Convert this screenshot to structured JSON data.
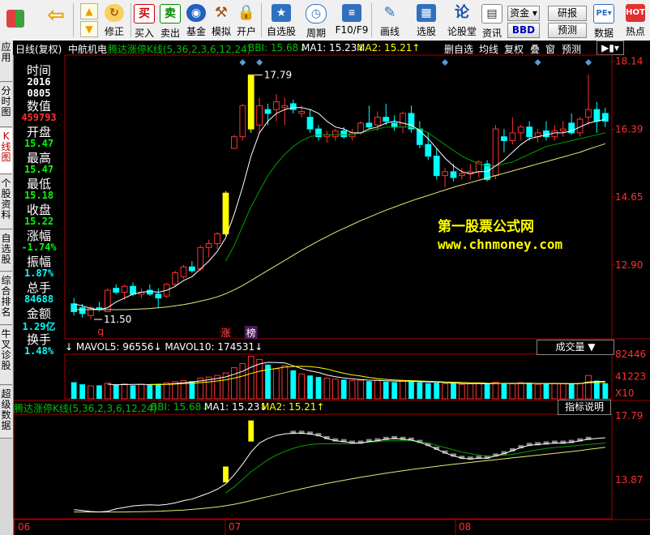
{
  "toolbar": {
    "buttons": [
      {
        "label": "",
        "icon": "windows-logo-icon"
      },
      {
        "label": "",
        "icon": "back-arrow-icon"
      },
      {
        "label": "修正",
        "icon": "refresh-icon"
      },
      {
        "label": "买入",
        "icon": "buy-icon"
      },
      {
        "label": "卖出",
        "icon": "sell-icon"
      },
      {
        "label": "基金",
        "icon": "fund-icon"
      },
      {
        "label": "模拟",
        "icon": "hammer-icon"
      },
      {
        "label": "开户",
        "icon": "lock-icon"
      },
      {
        "label": "自选股",
        "icon": "star-icon"
      },
      {
        "label": "周期",
        "icon": "clock-icon"
      },
      {
        "label": "F10/F9",
        "icon": "f10-icon"
      },
      {
        "label": "画线",
        "icon": "pen-icon"
      },
      {
        "label": "选股",
        "icon": "chart-screen-icon"
      },
      {
        "label": "论股堂",
        "icon": "lun-icon"
      },
      {
        "label": "资讯",
        "icon": "news-icon"
      },
      {
        "label": "数据",
        "icon": "pe-icon"
      },
      {
        "label": "热点",
        "icon": "hot-icon"
      }
    ],
    "zijin": "资金",
    "bbd": "BBD",
    "yanbao": "研报",
    "yuce": "预测"
  },
  "sidetabs": [
    "应用",
    "分时图",
    "K线图",
    "个股资料",
    "自选股",
    "综合排名",
    "牛叉诊股",
    "超级数据"
  ],
  "infobar": {
    "period": "日线(复权)",
    "name": "中航机电",
    "indicator": "腾达涨停K线(5,36,2,3,6,12,24)",
    "bbi": "BBI: 15.68↓",
    "ma1": "MA1: 15.23↓",
    "ma2": "MA2: 15.21↑",
    "right_buttons": [
      "删自选",
      "均线",
      "复权",
      "叠",
      "窗",
      "预测"
    ]
  },
  "info_panel": [
    {
      "label": "时间",
      "value": "",
      "color": "white"
    },
    {
      "label": "",
      "value": "2016",
      "color": "white"
    },
    {
      "label": "",
      "value": "0805",
      "color": "white"
    },
    {
      "label": "数值",
      "value": "459793",
      "color": "red"
    },
    {
      "label": "开盘",
      "value": "15.47",
      "color": "green"
    },
    {
      "label": "最高",
      "value": "15.47",
      "color": "green"
    },
    {
      "label": "最低",
      "value": "15.18",
      "color": "green"
    },
    {
      "label": "收盘",
      "value": "15.22",
      "color": "green"
    },
    {
      "label": "涨幅",
      "value": "-1.74%",
      "color": "green"
    },
    {
      "label": "振幅",
      "value": "1.87%",
      "color": "cyan"
    },
    {
      "label": "总手",
      "value": "84688",
      "color": "cyan"
    },
    {
      "label": "金额",
      "value": "1.29亿",
      "color": "cyan"
    },
    {
      "label": "换手",
      "value": "1.48%",
      "color": "cyan"
    }
  ],
  "watermark": {
    "line1": "第一股票公式网",
    "line2": "www.chnmoney.com"
  },
  "main_axis": [
    "18.14",
    "16.39",
    "14.65",
    "12.90"
  ],
  "annotations": {
    "high": "17.79",
    "low": "11.50",
    "q": "q",
    "zhang": "涨",
    "bang": "榜"
  },
  "volume_bar": {
    "left_text": "↓ MAVOL5: 96556↓ MAVOL10: 174531↓",
    "dropdown": "成交量",
    "axis": [
      "82446",
      "41223",
      "X10"
    ]
  },
  "lower_bar": {
    "indicator": "腾达涨停K线(5,36,2,3,6,12,24)",
    "bbi": "BBI: 15.68↓",
    "ma1": "MA1: 15.23↓",
    "ma2": "MA2: 15.21↑",
    "button": "指标说明",
    "axis": [
      "17.79",
      "13.87"
    ]
  },
  "date_axis": [
    "06",
    "07",
    "08"
  ],
  "colors": {
    "up": "#ff3232",
    "down": "#00ffff",
    "limit": "#ffff00",
    "ma_white": "#ffffff",
    "ma_green": "#00a000",
    "ma_yellow": "#e8e878"
  },
  "chart_data": {
    "type": "candlestick",
    "ylim": [
      11.0,
      18.3
    ],
    "candles": [
      {
        "o": 11.9,
        "h": 12.05,
        "l": 11.6,
        "c": 11.7
      },
      {
        "o": 11.8,
        "h": 11.9,
        "l": 11.55,
        "c": 11.65
      },
      {
        "o": 11.6,
        "h": 11.85,
        "l": 11.5,
        "c": 11.8
      },
      {
        "o": 11.8,
        "h": 11.95,
        "l": 11.7,
        "c": 11.75
      },
      {
        "o": 11.7,
        "h": 12.3,
        "l": 11.7,
        "c": 12.25
      },
      {
        "o": 12.3,
        "h": 12.4,
        "l": 12.15,
        "c": 12.2
      },
      {
        "o": 12.2,
        "h": 12.4,
        "l": 12.0,
        "c": 12.35
      },
      {
        "o": 12.35,
        "h": 12.45,
        "l": 12.1,
        "c": 12.15
      },
      {
        "o": 12.15,
        "h": 12.3,
        "l": 12.05,
        "c": 12.2
      },
      {
        "o": 12.25,
        "h": 12.4,
        "l": 12.1,
        "c": 12.15
      },
      {
        "o": 12.15,
        "h": 12.3,
        "l": 11.8,
        "c": 12.05
      },
      {
        "o": 12.1,
        "h": 12.45,
        "l": 12.05,
        "c": 12.4
      },
      {
        "o": 12.4,
        "h": 12.75,
        "l": 12.35,
        "c": 12.7
      },
      {
        "o": 12.6,
        "h": 12.9,
        "l": 12.55,
        "c": 12.85
      },
      {
        "o": 12.85,
        "h": 13.0,
        "l": 12.7,
        "c": 12.75
      },
      {
        "o": 12.8,
        "h": 13.4,
        "l": 12.75,
        "c": 13.35
      },
      {
        "o": 13.35,
        "h": 13.55,
        "l": 13.1,
        "c": 13.45
      },
      {
        "o": 13.45,
        "h": 13.75,
        "l": 13.3,
        "c": 13.7
      },
      {
        "o": 13.7,
        "h": 14.8,
        "l": 13.65,
        "c": 14.75
      },
      {
        "o": 15.9,
        "h": 16.25,
        "l": 15.9,
        "c": 16.2
      },
      {
        "o": 16.2,
        "h": 17.05,
        "l": 16.1,
        "c": 17.0
      },
      {
        "o": 17.79,
        "h": 17.79,
        "l": 16.3,
        "c": 16.4
      },
      {
        "o": 16.5,
        "h": 17.2,
        "l": 16.3,
        "c": 17.0
      },
      {
        "o": 16.9,
        "h": 17.05,
        "l": 16.5,
        "c": 16.8
      },
      {
        "o": 16.9,
        "h": 17.3,
        "l": 16.6,
        "c": 17.1
      },
      {
        "o": 16.95,
        "h": 17.2,
        "l": 16.5,
        "c": 17.0
      },
      {
        "o": 17.05,
        "h": 17.15,
        "l": 16.8,
        "c": 16.9
      },
      {
        "o": 16.8,
        "h": 17.0,
        "l": 16.7,
        "c": 16.85
      },
      {
        "o": 16.7,
        "h": 16.9,
        "l": 16.3,
        "c": 16.4
      },
      {
        "o": 16.4,
        "h": 16.5,
        "l": 16.1,
        "c": 16.2
      },
      {
        "o": 16.2,
        "h": 16.35,
        "l": 16.05,
        "c": 16.25
      },
      {
        "o": 16.2,
        "h": 16.4,
        "l": 16.1,
        "c": 16.35
      },
      {
        "o": 16.35,
        "h": 16.45,
        "l": 16.15,
        "c": 16.2
      },
      {
        "o": 16.2,
        "h": 16.4,
        "l": 16.1,
        "c": 16.3
      },
      {
        "o": 16.3,
        "h": 16.6,
        "l": 16.25,
        "c": 16.55
      },
      {
        "o": 16.55,
        "h": 17.0,
        "l": 16.4,
        "c": 16.45
      },
      {
        "o": 16.5,
        "h": 16.85,
        "l": 16.35,
        "c": 16.7
      },
      {
        "o": 16.7,
        "h": 17.05,
        "l": 16.5,
        "c": 16.6
      },
      {
        "o": 16.55,
        "h": 16.75,
        "l": 16.35,
        "c": 16.45
      },
      {
        "o": 16.45,
        "h": 16.85,
        "l": 16.3,
        "c": 16.8
      },
      {
        "o": 16.8,
        "h": 17.0,
        "l": 16.3,
        "c": 16.4
      },
      {
        "o": 16.4,
        "h": 16.6,
        "l": 15.9,
        "c": 16.0
      },
      {
        "o": 16.0,
        "h": 16.3,
        "l": 15.6,
        "c": 15.7
      },
      {
        "o": 15.7,
        "h": 15.9,
        "l": 15.1,
        "c": 15.2
      },
      {
        "o": 15.2,
        "h": 15.4,
        "l": 14.9,
        "c": 15.3
      },
      {
        "o": 15.3,
        "h": 15.5,
        "l": 15.05,
        "c": 15.15
      },
      {
        "o": 15.2,
        "h": 15.4,
        "l": 15.1,
        "c": 15.25
      },
      {
        "o": 15.25,
        "h": 15.5,
        "l": 15.1,
        "c": 15.3
      },
      {
        "o": 15.3,
        "h": 15.6,
        "l": 15.15,
        "c": 15.55
      },
      {
        "o": 15.5,
        "h": 15.6,
        "l": 15.05,
        "c": 15.1
      },
      {
        "o": 15.2,
        "h": 16.5,
        "l": 15.1,
        "c": 16.4
      },
      {
        "o": 16.2,
        "h": 16.4,
        "l": 15.8,
        "c": 16.1
      },
      {
        "o": 16.1,
        "h": 16.7,
        "l": 16.0,
        "c": 16.3
      },
      {
        "o": 16.3,
        "h": 16.5,
        "l": 16.1,
        "c": 16.45
      },
      {
        "o": 16.45,
        "h": 16.6,
        "l": 16.1,
        "c": 16.2
      },
      {
        "o": 16.2,
        "h": 16.4,
        "l": 16.05,
        "c": 16.3
      },
      {
        "o": 16.35,
        "h": 16.6,
        "l": 16.1,
        "c": 16.2
      },
      {
        "o": 16.2,
        "h": 16.5,
        "l": 16.1,
        "c": 16.35
      },
      {
        "o": 16.35,
        "h": 16.6,
        "l": 16.2,
        "c": 16.4
      },
      {
        "o": 16.55,
        "h": 16.8,
        "l": 16.25,
        "c": 16.3
      },
      {
        "o": 16.3,
        "h": 16.7,
        "l": 16.2,
        "c": 16.65
      },
      {
        "o": 16.7,
        "h": 17.8,
        "l": 16.5,
        "c": 16.9
      },
      {
        "o": 16.9,
        "h": 17.1,
        "l": 16.3,
        "c": 16.6
      },
      {
        "o": 16.8,
        "h": 16.95,
        "l": 16.45,
        "c": 16.6
      }
    ],
    "limit_up_days": [
      18,
      21
    ],
    "volumes": [
      3.2,
      2.8,
      2.5,
      2.6,
      3.0,
      2.7,
      2.9,
      2.6,
      2.8,
      2.7,
      2.9,
      3.1,
      3.3,
      3.5,
      3.4,
      4.0,
      4.2,
      4.5,
      5.0,
      6.0,
      6.8,
      8.2,
      7.6,
      6.6,
      5.8,
      6.4,
      5.5,
      4.8,
      4.5,
      4.2,
      4.0,
      3.8,
      3.7,
      3.5,
      3.6,
      3.4,
      3.6,
      3.3,
      3.2,
      3.5,
      3.4,
      3.2,
      3.0,
      3.1,
      2.9,
      3.0,
      2.8,
      2.9,
      3.0,
      2.8,
      3.2,
      3.0,
      2.9,
      3.1,
      3.0,
      2.8,
      2.9,
      3.0,
      2.9,
      2.8,
      3.0,
      4.5,
      3.5,
      3.0
    ],
    "ma_white": [
      11.9,
      11.85,
      11.78,
      11.75,
      11.8,
      11.95,
      12.05,
      12.15,
      12.2,
      12.22,
      12.2,
      12.25,
      12.35,
      12.5,
      12.6,
      12.8,
      13.0,
      13.25,
      13.6,
      14.2,
      14.9,
      15.7,
      16.3,
      16.6,
      16.8,
      16.9,
      16.95,
      16.95,
      16.9,
      16.8,
      16.6,
      16.45,
      16.4,
      16.3,
      16.3,
      16.4,
      16.45,
      16.55,
      16.6,
      16.55,
      16.5,
      16.35,
      16.15,
      15.9,
      15.65,
      15.45,
      15.3,
      15.25,
      15.3,
      15.3,
      15.45,
      15.6,
      15.8,
      16.0,
      16.15,
      16.2,
      16.25,
      16.3,
      16.3,
      16.35,
      16.45,
      16.55,
      16.6,
      16.65
    ],
    "ma_green": [
      null,
      null,
      null,
      null,
      null,
      null,
      null,
      null,
      null,
      null,
      null,
      null,
      null,
      null,
      null,
      null,
      null,
      null,
      13.0,
      13.4,
      13.9,
      14.4,
      14.8,
      15.2,
      15.5,
      15.75,
      15.95,
      16.1,
      16.2,
      16.25,
      16.25,
      16.25,
      16.25,
      16.25,
      16.3,
      16.35,
      16.4,
      16.45,
      16.45,
      16.45,
      16.45,
      16.4,
      16.3,
      16.15,
      16.0,
      15.85,
      15.7,
      15.6,
      15.5,
      15.45,
      15.45,
      15.5,
      15.55,
      15.65,
      15.75,
      15.85,
      15.95,
      16.0,
      16.05,
      16.1,
      16.15,
      16.2,
      16.25,
      16.3
    ],
    "ma_yellow": [
      11.75,
      11.75,
      11.75,
      11.75,
      11.75,
      11.75,
      11.75,
      11.76,
      11.77,
      11.78,
      11.8,
      11.82,
      11.85,
      11.88,
      11.92,
      11.97,
      12.02,
      12.08,
      12.16,
      12.26,
      12.37,
      12.5,
      12.63,
      12.76,
      12.89,
      13.02,
      13.15,
      13.28,
      13.4,
      13.52,
      13.63,
      13.74,
      13.84,
      13.94,
      14.04,
      14.13,
      14.22,
      14.31,
      14.39,
      14.47,
      14.55,
      14.62,
      14.69,
      14.76,
      14.83,
      14.9,
      14.96,
      15.02,
      15.08,
      15.14,
      15.2,
      15.26,
      15.32,
      15.38,
      15.44,
      15.5,
      15.56,
      15.62,
      15.68,
      15.74,
      15.8,
      15.88,
      15.95,
      16.02
    ]
  }
}
